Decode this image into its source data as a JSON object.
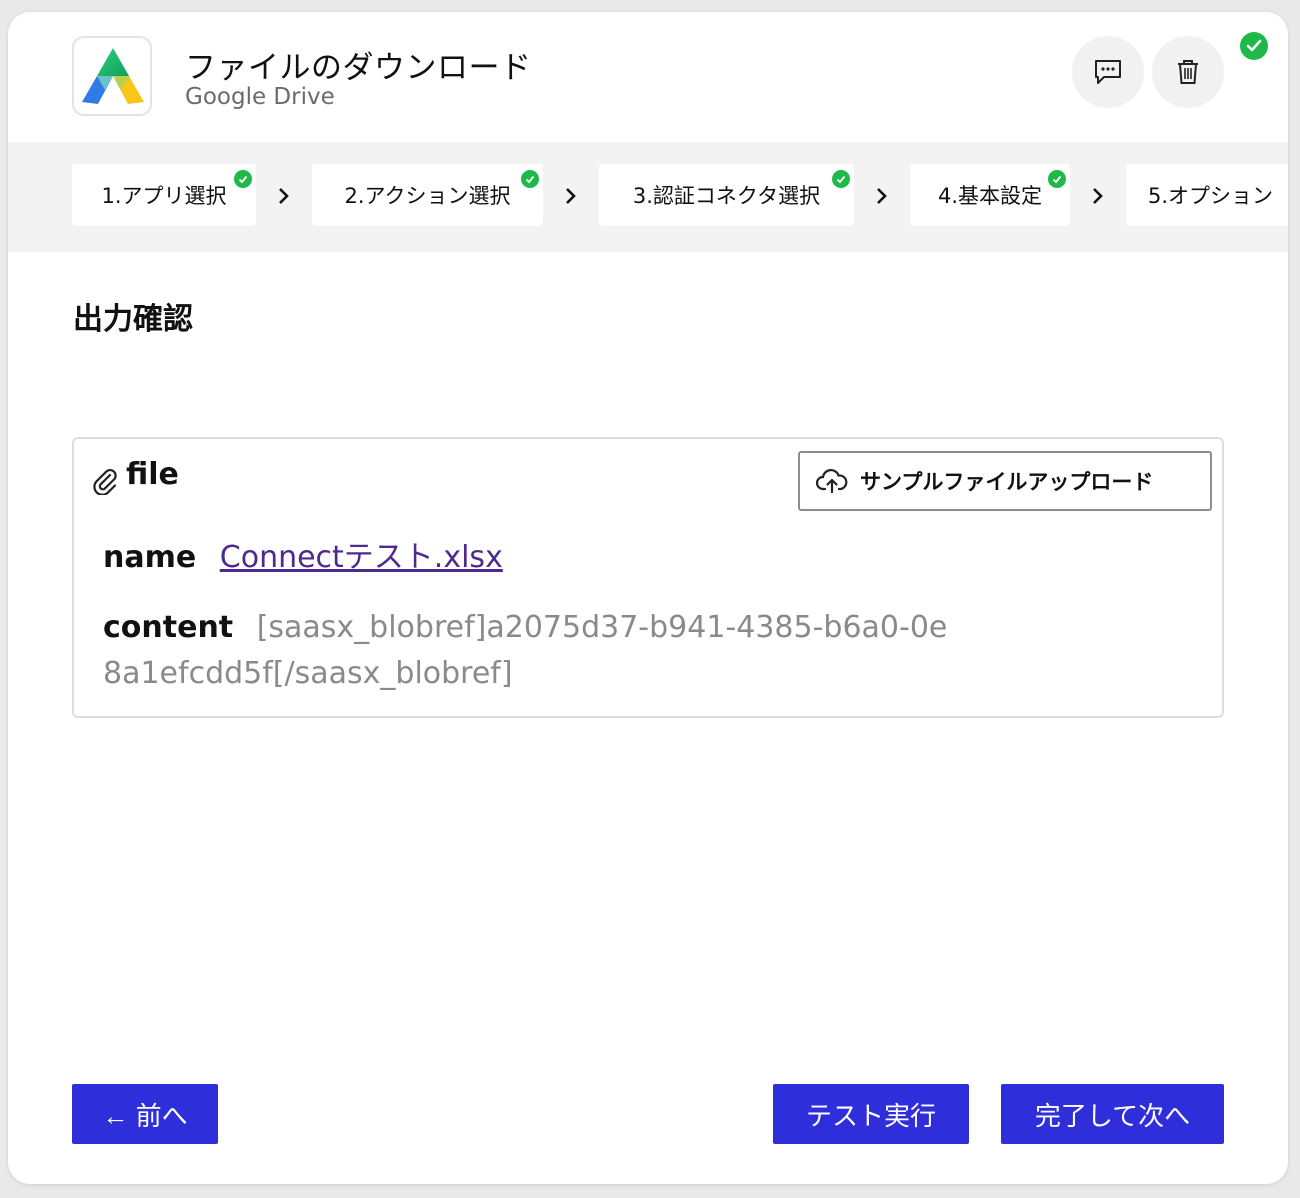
{
  "header": {
    "title": "ファイルのダウンロード",
    "subtitle": "Google Drive",
    "icons": [
      "google-drive-logo",
      "comment-icon",
      "trash-icon",
      "check-circle-icon"
    ],
    "status_color": "#1fb94a"
  },
  "steps": [
    {
      "label": "1.アプリ選択",
      "done": true
    },
    {
      "label": "2.アクション選択",
      "done": true
    },
    {
      "label": "3.認証コネクタ選択",
      "done": true
    },
    {
      "label": "4.基本設定",
      "done": true
    },
    {
      "label": "5.オプション",
      "done": false
    }
  ],
  "section": {
    "title": "出力確認"
  },
  "file": {
    "label": "file",
    "upload_label": "サンプルファイルアップロード",
    "name_key": "name",
    "name_value": "Connectテスト.xlsx",
    "content_key": "content",
    "content_value": "[saasx_blobref]a2075d37-b941-4385-b6a0-0e8a1efcdd5f[/saasx_blobref]"
  },
  "footer": {
    "prev_label": "← 前へ",
    "test_label": "テスト実行",
    "next_label": "完了して次へ"
  },
  "colors": {
    "primary": "#2e2edb",
    "success": "#1fb94a",
    "link": "#4d2a8f"
  }
}
